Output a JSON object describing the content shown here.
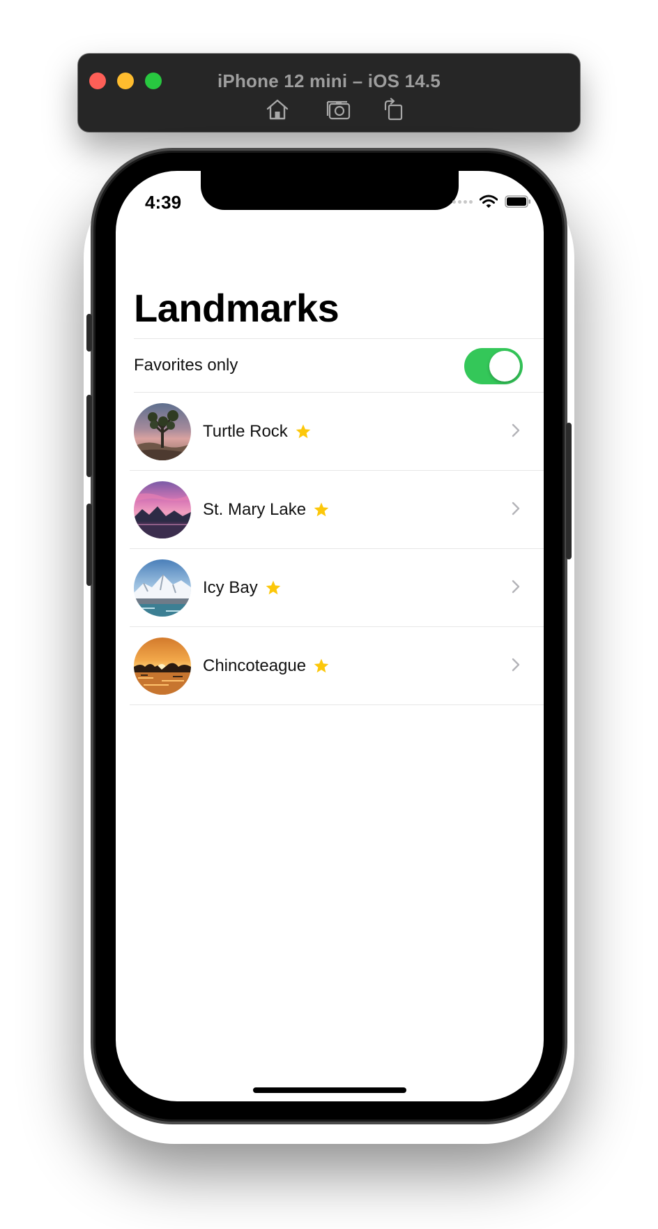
{
  "window": {
    "title": "iPhone 12 mini – iOS 14.5",
    "toolbar": [
      {
        "icon": "home-icon",
        "label": "Home"
      },
      {
        "icon": "screenshot-icon",
        "label": "Screenshot"
      },
      {
        "icon": "rotate-icon",
        "label": "Rotate"
      }
    ]
  },
  "status_bar": {
    "time": "4:39"
  },
  "app": {
    "title": "Landmarks",
    "favorites_toggle": {
      "label": "Favorites only",
      "on": true
    },
    "landmarks": [
      {
        "name": "Turtle Rock",
        "favorite": true
      },
      {
        "name": "St. Mary Lake",
        "favorite": true
      },
      {
        "name": "Icy Bay",
        "favorite": true
      },
      {
        "name": "Chincoteague",
        "favorite": true
      }
    ]
  },
  "colors": {
    "toggle_on": "#34c759",
    "star": "#fcc70a",
    "chevron": "#b3b3b8"
  }
}
